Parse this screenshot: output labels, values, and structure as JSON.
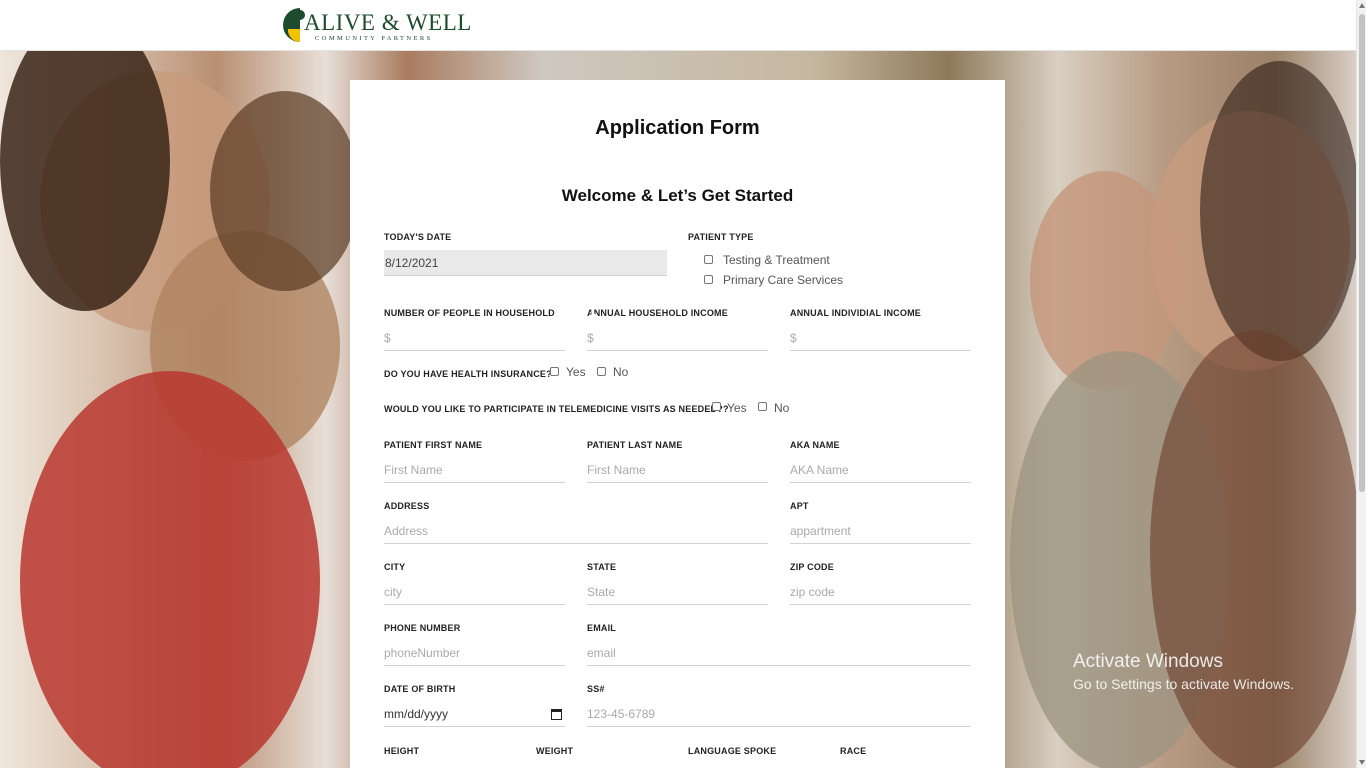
{
  "header": {
    "logo_text": "ALIVE & WELL",
    "logo_sub": "COMMUNITY PARTNERS"
  },
  "form": {
    "title": "Application Form",
    "subtitle": "Welcome & Let’s Get Started",
    "todays_date": {
      "label": "TODAY'S DATE",
      "value": "8/12/2021"
    },
    "patient_type": {
      "label": "PATIENT TYPE",
      "options": [
        "Testing & Treatment",
        "Primary Care Services"
      ]
    },
    "household": {
      "label": "NUMBER OF PEOPLE IN HOUSEHOLD",
      "placeholder": "$"
    },
    "household_income": {
      "label": "ANNUAL HOUSEHOLD INCOME",
      "placeholder": "$"
    },
    "individual_income": {
      "label": "ANNUAL INDIVIDIAL INCOME",
      "placeholder": "$"
    },
    "insurance": {
      "label": "DO YOU HAVE HEALTH INSURANCE?",
      "yes": "Yes",
      "no": "No"
    },
    "telemedicine": {
      "label": "WOULD YOU LIKE TO PARTICIPATE IN TELEMEDICINE VISITS AS NEEDED??",
      "yes": "Yes",
      "no": "No"
    },
    "first_name": {
      "label": "PATIENT FIRST NAME",
      "placeholder": "First Name"
    },
    "last_name": {
      "label": "PATIENT LAST NAME",
      "placeholder": "First Name"
    },
    "aka_name": {
      "label": "AKA NAME",
      "placeholder": "AKA Name"
    },
    "address": {
      "label": "ADDRESS",
      "placeholder": "Address"
    },
    "apt": {
      "label": "APT",
      "placeholder": "appartment"
    },
    "city": {
      "label": "CITY",
      "placeholder": "city"
    },
    "state": {
      "label": "STATE",
      "placeholder": "State"
    },
    "zip": {
      "label": "ZIP CODE",
      "placeholder": "zip code"
    },
    "phone": {
      "label": "PHONE NUMBER",
      "placeholder": "phoneNumber"
    },
    "email": {
      "label": "EMAIL",
      "placeholder": "email"
    },
    "dob": {
      "label": "DATE OF BIRTH",
      "value": "mm/dd/yyyy"
    },
    "ssn": {
      "label": "SS#",
      "placeholder": "123-45-6789"
    },
    "height": {
      "label": "HEIGHT"
    },
    "weight": {
      "label": "WEIGHT"
    },
    "language": {
      "label": "LANGUAGE SPOKE"
    },
    "race": {
      "label": "RACE"
    }
  },
  "watermark": {
    "line1": "Activate Windows",
    "line2": "Go to Settings to activate Windows."
  },
  "colors": {
    "logo_green": "#1e4a2e",
    "logo_yellow": "#f2c200"
  }
}
